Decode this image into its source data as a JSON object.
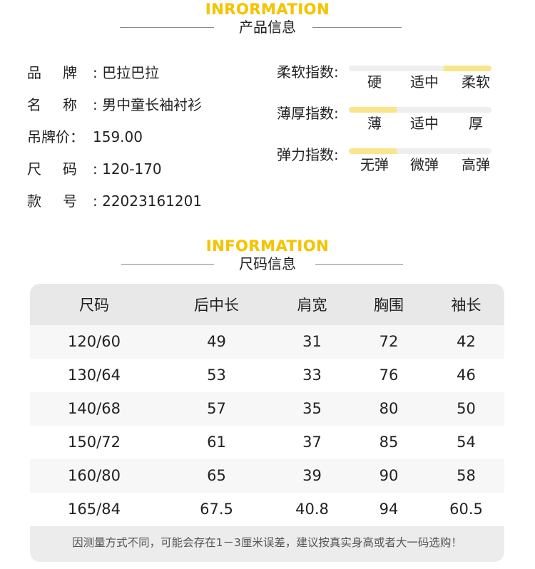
{
  "product_section": {
    "heading_en": "INRORMATION",
    "heading_cn": "产品信息"
  },
  "product_info": [
    {
      "label_a": "品",
      "label_b": "牌",
      "value": ": 巴拉巴拉"
    },
    {
      "label_a": "名",
      "label_b": "称",
      "value": ": 男中童长袖衬衫"
    },
    {
      "label_full": "吊牌价：",
      "value": "159.00"
    },
    {
      "label_a": "尺",
      "label_b": "码",
      "value": ": 120-170"
    },
    {
      "label_a": "款",
      "label_b": "号",
      "value": ": 22023161201"
    }
  ],
  "indices": [
    {
      "label": "柔软指数:",
      "options": [
        "硬",
        "适中",
        "柔软"
      ],
      "selected_index": 2
    },
    {
      "label": "薄厚指数:",
      "options": [
        "薄",
        "适中",
        "厚"
      ],
      "selected_index": 0
    },
    {
      "label": "弹力指数:",
      "options": [
        "无弹",
        "微弹",
        "高弹"
      ],
      "selected_index": 0
    }
  ],
  "size_section": {
    "heading_en": "INFORMATION",
    "heading_cn": "尺码信息"
  },
  "size_table": {
    "headers": [
      "尺码",
      "后中长",
      "肩宽",
      "胸围",
      "袖长"
    ],
    "rows": [
      [
        "120/60",
        "49",
        "31",
        "72",
        "42"
      ],
      [
        "130/64",
        "53",
        "33",
        "76",
        "46"
      ],
      [
        "140/68",
        "57",
        "35",
        "80",
        "50"
      ],
      [
        "150/72",
        "61",
        "37",
        "85",
        "54"
      ],
      [
        "160/80",
        "65",
        "39",
        "90",
        "58"
      ],
      [
        "165/84",
        "67.5",
        "40.8",
        "94",
        "60.5"
      ]
    ],
    "note": "因测量方式不同，可能会存在1－3厘米误差，建议按真实身高或者大一码选购！"
  },
  "colors": {
    "heading_yellow": "#f5c400",
    "indicator_fill": "#fbe58a",
    "indicator_track": "#eeeeee",
    "table_header_bg": "#e8e8e8"
  }
}
